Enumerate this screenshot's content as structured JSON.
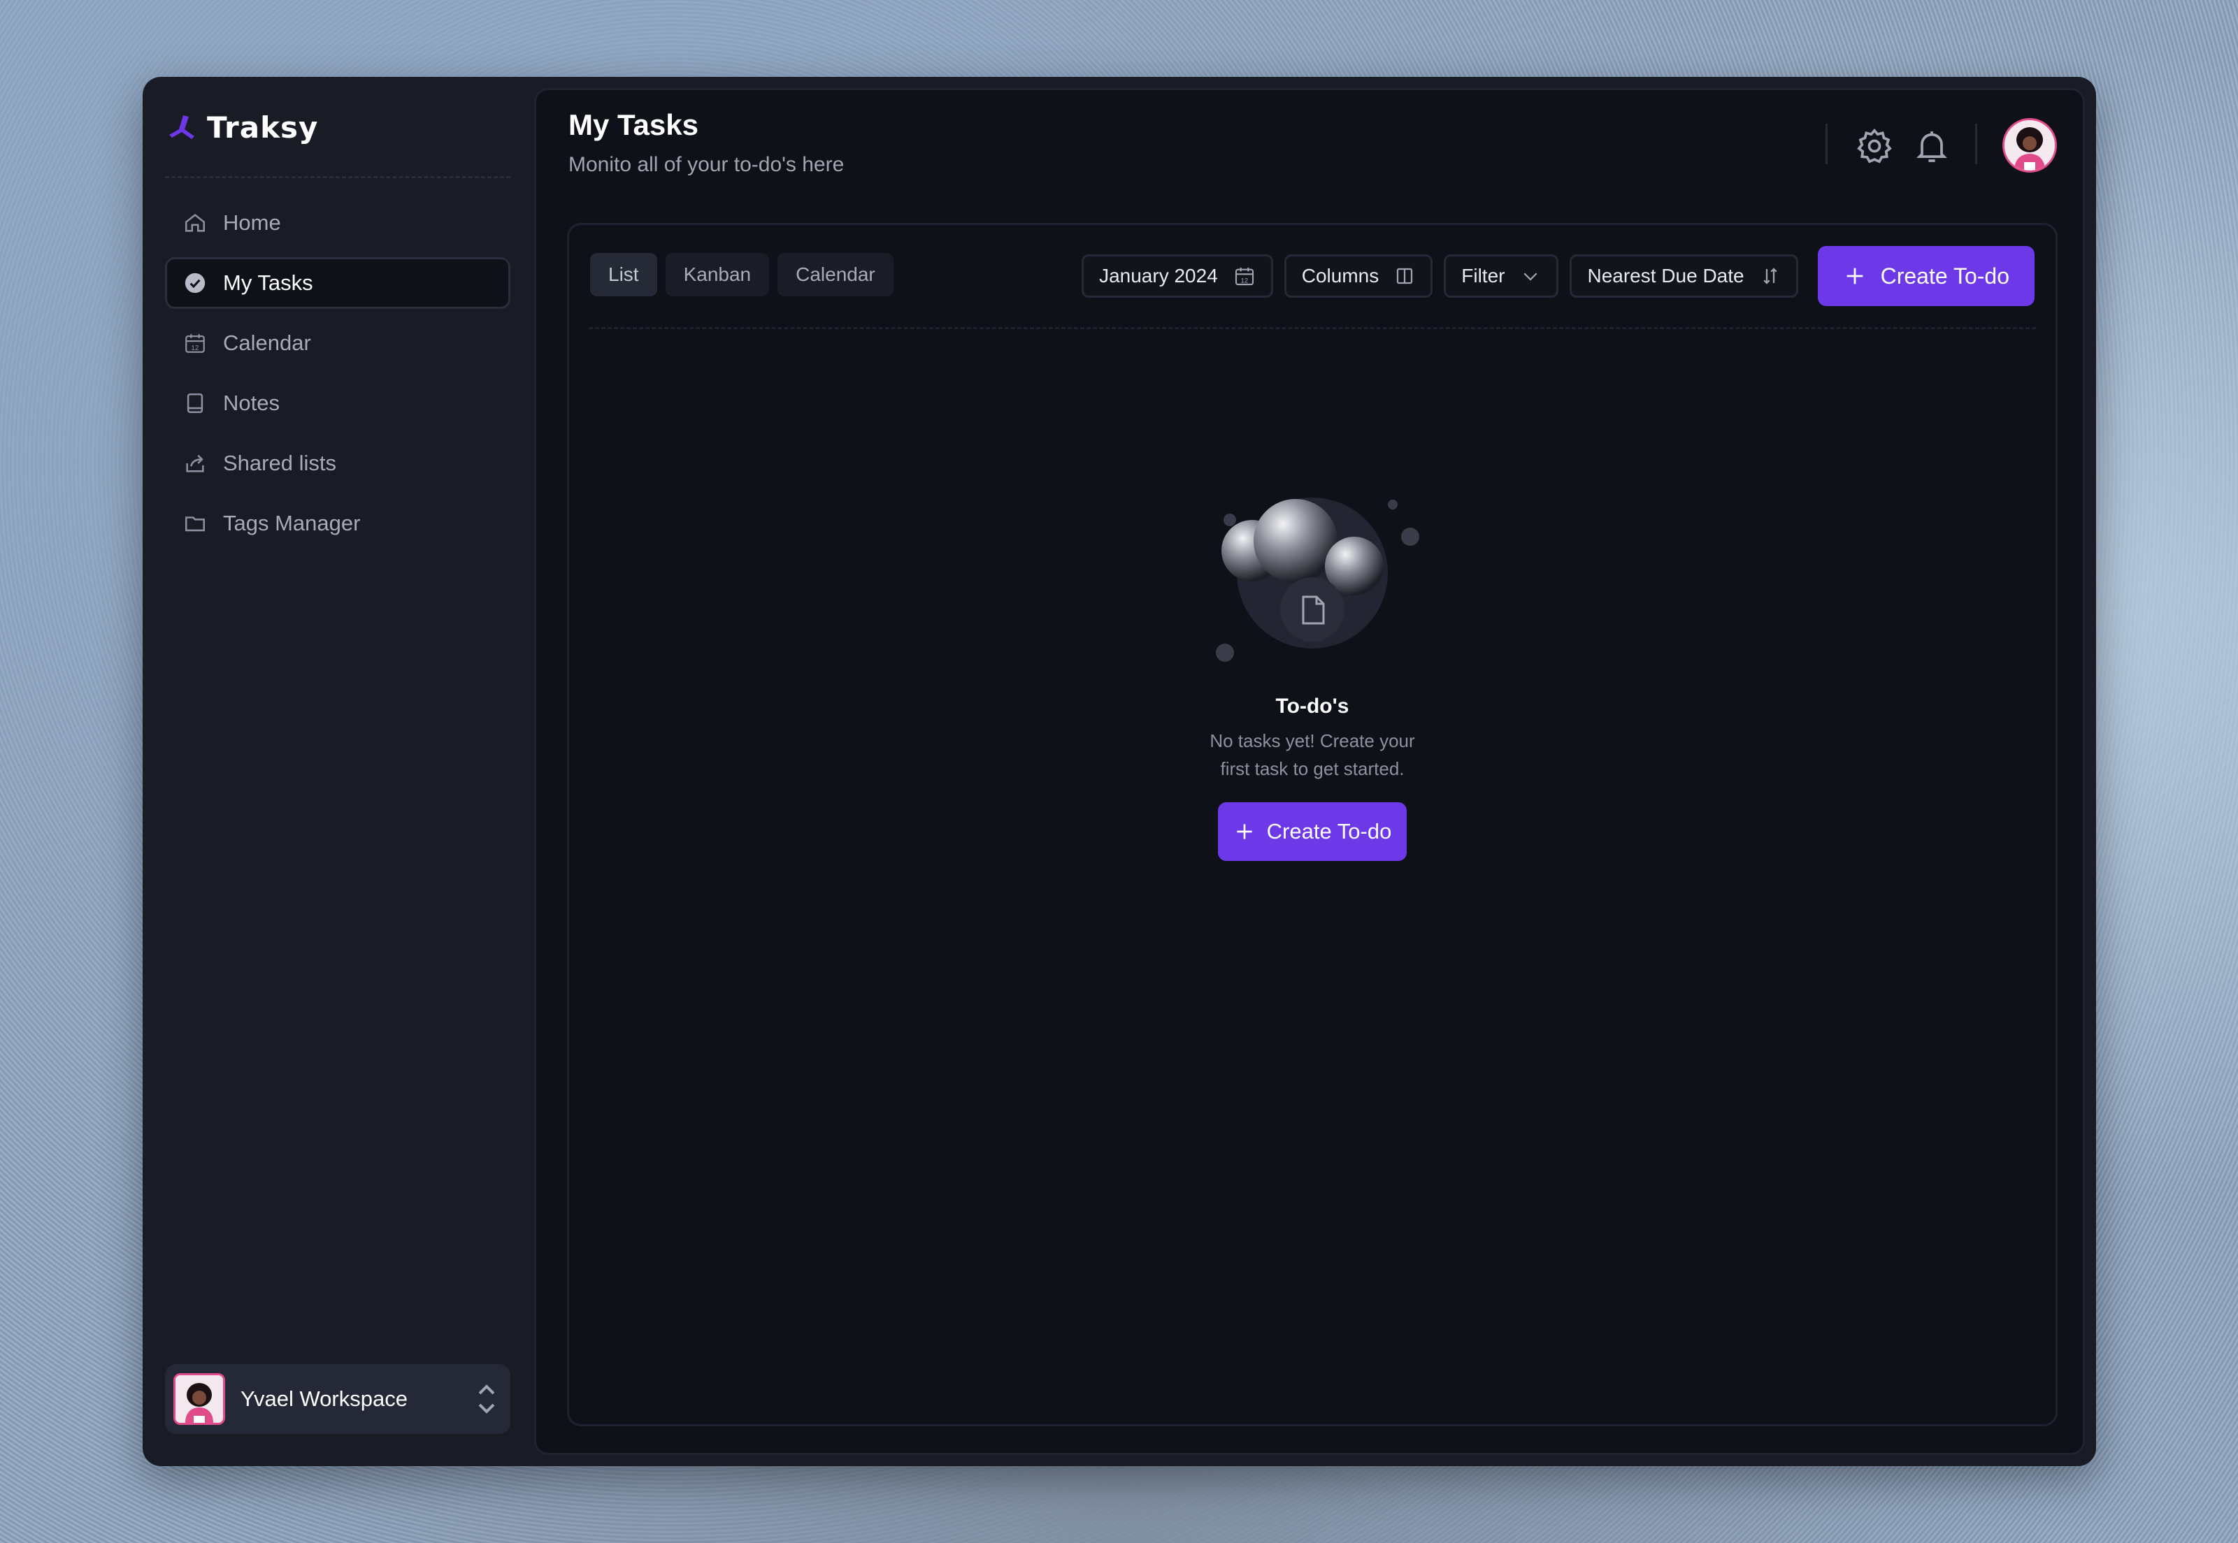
{
  "app": {
    "logo_text": "Traksy",
    "brand_color": "#6c38e8"
  },
  "sidebar": {
    "items": [
      {
        "label": "Home",
        "icon": "home-icon",
        "active": false
      },
      {
        "label": "My Tasks",
        "icon": "check-circle-icon",
        "active": true
      },
      {
        "label": "Calendar",
        "icon": "calendar-icon",
        "active": false
      },
      {
        "label": "Notes",
        "icon": "notebook-icon",
        "active": false
      },
      {
        "label": "Shared lists",
        "icon": "share-icon",
        "active": false
      },
      {
        "label": "Tags Manager",
        "icon": "folder-icon",
        "active": false
      }
    ],
    "workspace": {
      "name": "Yvael Workspace"
    }
  },
  "header": {
    "title": "My Tasks",
    "subtitle": "Monito all of your to-do's here",
    "icons": [
      "settings-icon",
      "bell-icon"
    ]
  },
  "toolbar": {
    "tabs": [
      "List",
      "Kanban",
      "Calendar"
    ],
    "active_tab": "List",
    "date": "January 2024",
    "columns": "Columns",
    "filter": "Filter",
    "sort": "Nearest Due Date",
    "create": "Create To-do"
  },
  "empty_state": {
    "title": "To-do's",
    "text": "No tasks yet! Create your first task to get started.",
    "button": "Create To-do"
  }
}
